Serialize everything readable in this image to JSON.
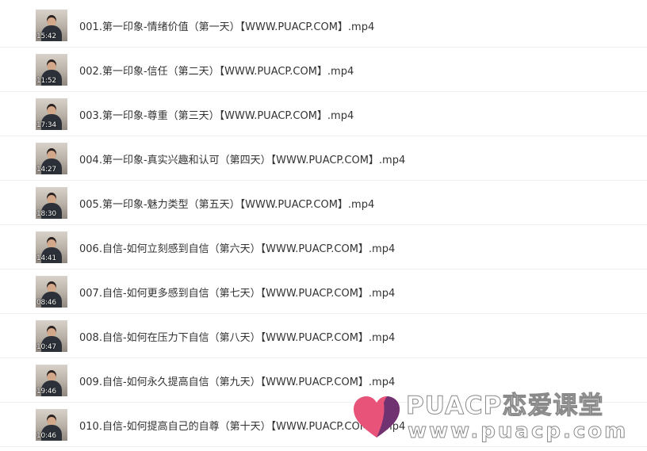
{
  "files": [
    {
      "name": "001.第一印象-情绪价值（第一天）【WWW.PUACP.COM】.mp4",
      "duration": "15:42"
    },
    {
      "name": "002.第一印象-信任（第二天）【WWW.PUACP.COM】.mp4",
      "duration": "11:52"
    },
    {
      "name": "003.第一印象-尊重（第三天）【WWW.PUACP.COM】.mp4",
      "duration": "17:34"
    },
    {
      "name": "004.第一印象-真实兴趣和认可（第四天）【WWW.PUACP.COM】.mp4",
      "duration": "14:27"
    },
    {
      "name": "005.第一印象-魅力类型（第五天）【WWW.PUACP.COM】.mp4",
      "duration": "18:30"
    },
    {
      "name": "006.自信-如何立刻感到自信（第六天）【WWW.PUACP.COM】.mp4",
      "duration": "14:41"
    },
    {
      "name": "007.自信-如何更多感到自信（第七天）【WWW.PUACP.COM】.mp4",
      "duration": "08:46"
    },
    {
      "name": "008.自信-如何在压力下自信（第八天）【WWW.PUACP.COM】.mp4",
      "duration": "10:47"
    },
    {
      "name": "009.自信-如何永久提高自信（第九天）【WWW.PUACP.COM】.mp4",
      "duration": "19:46"
    },
    {
      "name": "010.自信-如何提高自己的自尊（第十天）【WWW.PUACP.COM】.mp4",
      "duration": "10:46"
    }
  ],
  "watermark": {
    "brand": "PUACP恋爱课堂",
    "url": "www.puacp.com",
    "icon": "heart-logo-icon",
    "colors": {
      "heart_left": "#e8537a",
      "heart_right": "#5a2d6e"
    }
  }
}
